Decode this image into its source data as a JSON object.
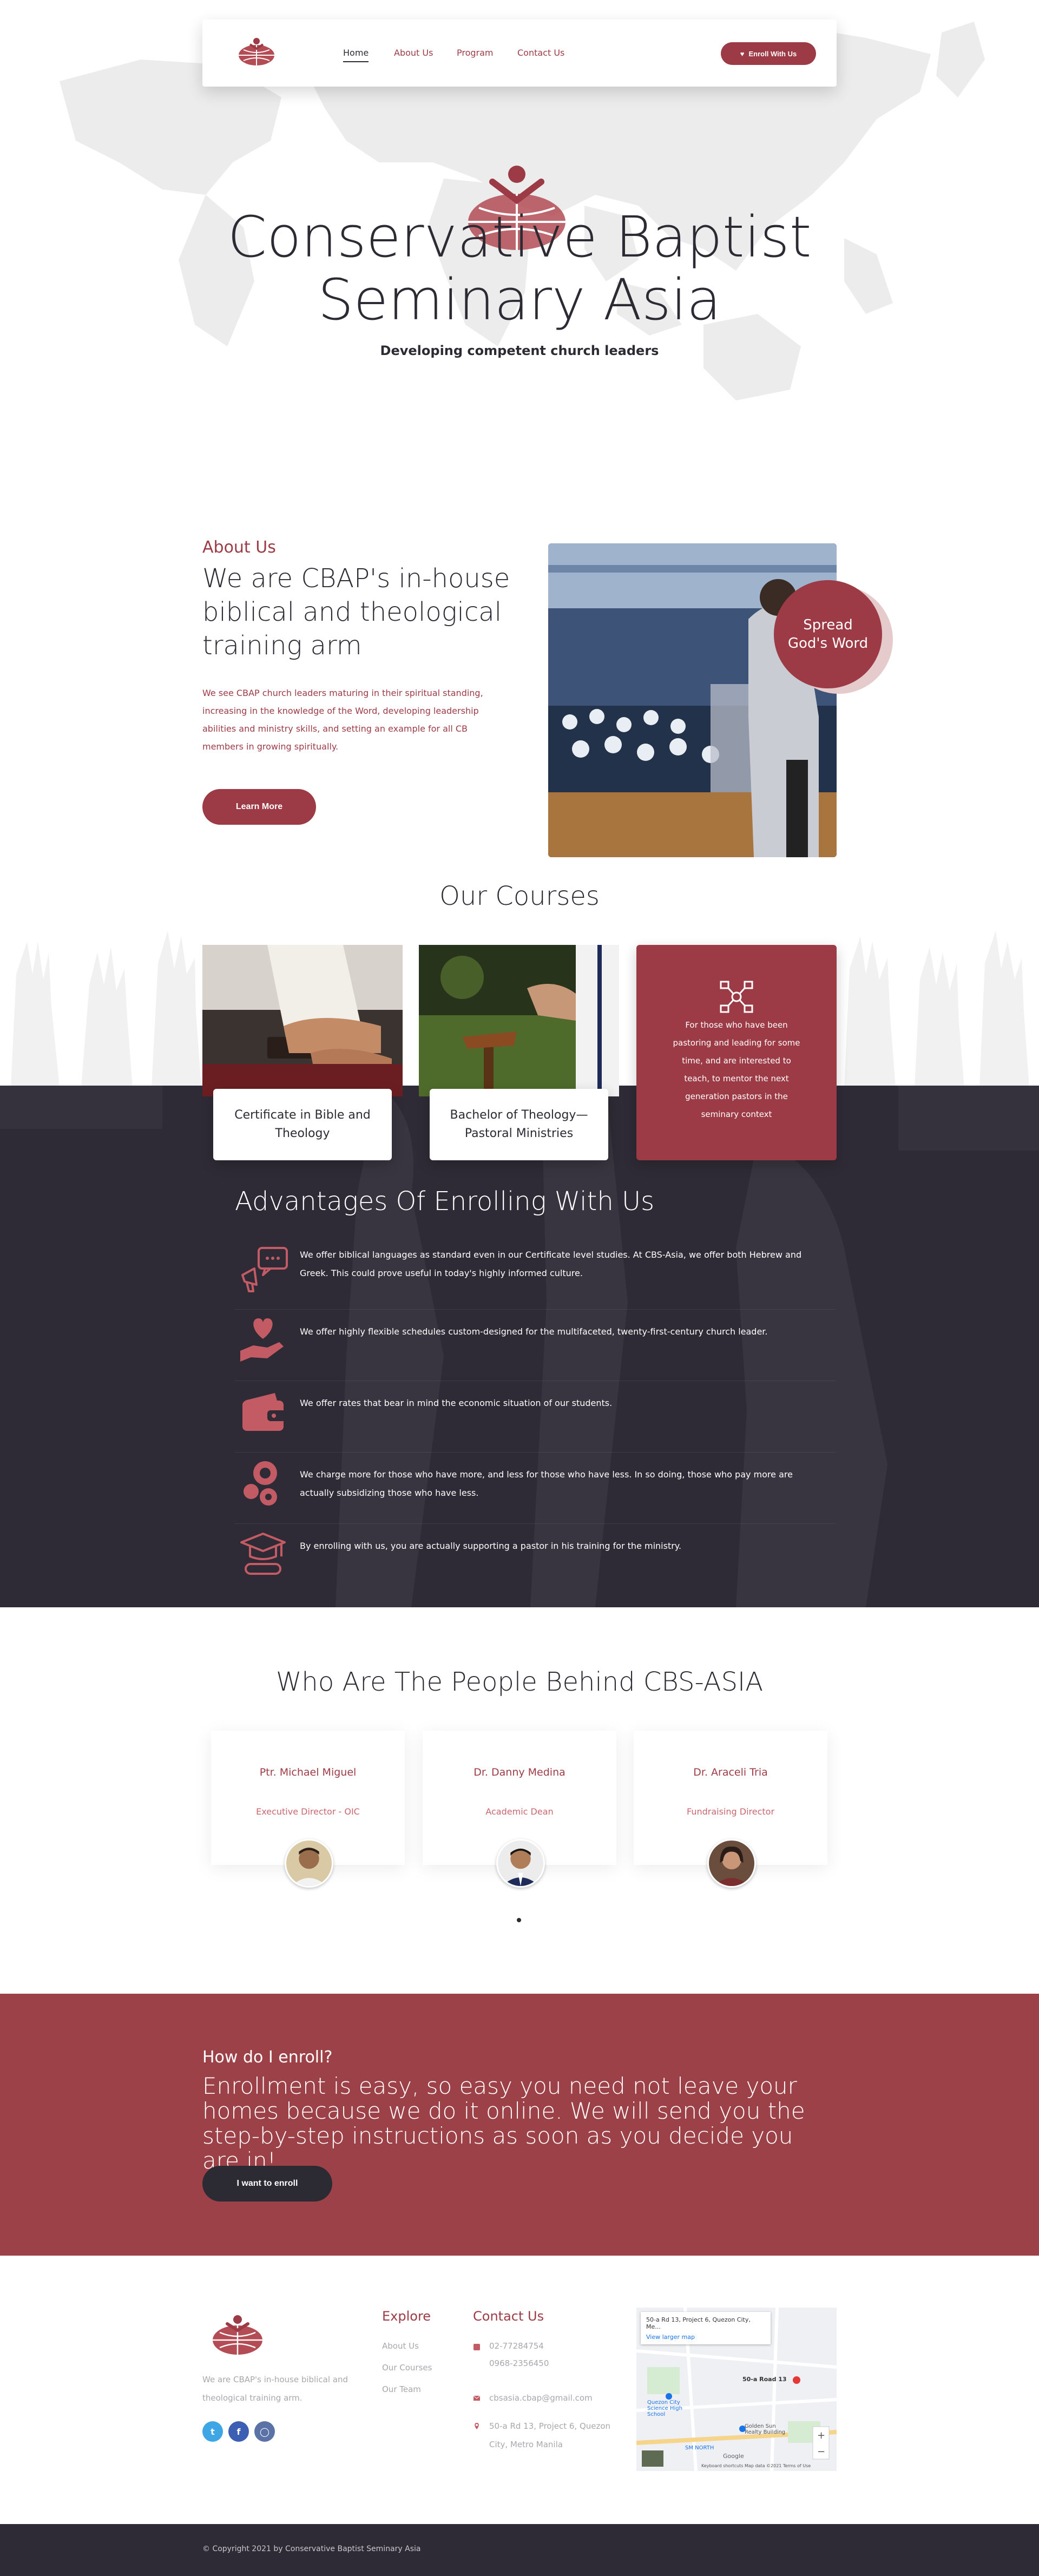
{
  "nav": {
    "links": [
      "Home",
      "About Us",
      "Program",
      "Contact Us"
    ],
    "enroll_label": "Enroll With Us"
  },
  "hero": {
    "title": "Conservative Baptist Seminary Asia",
    "subtitle": "Developing competent church leaders"
  },
  "about": {
    "kicker": "About Us",
    "heading": "We are CBAP's in-house biblical and theological training arm",
    "text": "We see CBAP church leaders maturing in their spiritual standing, increasing in the knowledge of the Word, developing leadership abilities and ministry skills, and setting an example for all CB members in growing spiritually.",
    "button": "Learn More",
    "badge": "Spread God's Word"
  },
  "courses": {
    "title": "Our Courses",
    "items": [
      {
        "label": "Certificate in Bible and Theology"
      },
      {
        "label": "Bachelor of Theology—Pastoral Ministries"
      },
      {
        "text": "For those who have been pastoring and leading for some time, and are interested to teach, to mentor the next generation pastors in the seminary context"
      }
    ]
  },
  "advantages": {
    "title": "Advantages Of Enrolling With Us",
    "items": [
      {
        "icon": "megaphone-icon",
        "text": "We offer biblical languages as standard even in our Certificate level studies. At CBS-Asia, we offer both Hebrew and Greek. This could prove useful in today's highly informed culture."
      },
      {
        "icon": "heart-hand-icon",
        "text": "We offer highly flexible schedules custom-designed for the multifaceted, twenty-first-century church leader."
      },
      {
        "icon": "wallet-icon",
        "text": "We offer rates that bear in mind the economic situation of our students."
      },
      {
        "icon": "coins-icon",
        "text": "We charge more for those who have more, and less for those who have less. In so doing, those who pay more are actually subsidizing those who have less."
      },
      {
        "icon": "graduation-cap-icon",
        "text": "By enrolling with us, you are actually supporting a pastor in his training for the ministry."
      }
    ]
  },
  "people": {
    "title": "Who Are The People Behind CBS-ASIA",
    "members": [
      {
        "name": "Ptr. Michael Miguel",
        "role": "Executive Director - OIC"
      },
      {
        "name": "Dr. Danny Medina",
        "role": "Academic Dean"
      },
      {
        "name": "Dr. Araceli Tria",
        "role": "Fundraising Director"
      }
    ]
  },
  "enroll": {
    "kicker": "How do I enroll?",
    "text": "Enrollment is easy, so easy you need not leave your homes because we do it online. We will send you the step-by-step instructions as soon as you decide you are in!",
    "button": "I want to enroll"
  },
  "footer": {
    "about": "We are CBAP's in-house biblical and theological training arm.",
    "explore_title": "Explore",
    "explore_links": [
      "About Us",
      "Our Courses",
      "Our Team"
    ],
    "contact_title": "Contact Us",
    "phone_1": "02-77284754",
    "phone_2": "0968-2356450",
    "email": "cbsasia.cbap@gmail.com",
    "address_1": "50-a Rd 13, Project 6, Quezon",
    "address_2": "City, Metro Manila",
    "map": {
      "card_title": "50-a Rd 13, Project 6, Quezon City, Me...",
      "card_link": "View larger map",
      "pin_label": "50-a Road 13",
      "place_1": "Quezon City Science High School",
      "place_2": "Golden Sun Realty Building",
      "place_3": "SM NORTH",
      "footer_note": "Keyboard shortcuts  Map data ©2021  Terms of Use",
      "brand": "Google"
    },
    "copyright": "© Copyright 2021 by Conservative Baptist Seminary Asia"
  },
  "colors": {
    "brand": "#9c3b45",
    "dark": "#2e2b36",
    "text": "#2c2a33",
    "muted": "#a9a7ad"
  }
}
